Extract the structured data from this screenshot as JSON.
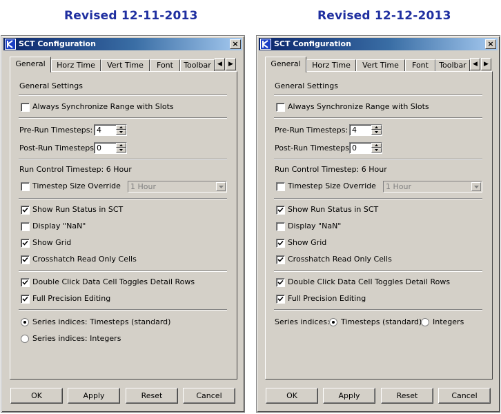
{
  "captions": {
    "left": "Revised 12-11-2013",
    "right": "Revised 12-12-2013"
  },
  "dialog": {
    "title": "SCT Configuration",
    "close_glyph": "×",
    "tabs": [
      "General",
      "Horz Time",
      "Vert Time",
      "Font",
      "Toolbar"
    ],
    "active_tab": "General",
    "section_title": "General Settings",
    "sync_range": {
      "label": "Always Synchronize Range with Slots",
      "checked": false
    },
    "pre_run": {
      "label": "Pre-Run Timesteps:",
      "value": "4"
    },
    "post_run": {
      "label": "Post-Run Timesteps:",
      "value": "0"
    },
    "run_control": "Run Control Timestep:  6 Hour",
    "timestep_override": {
      "label": "Timestep Size Override",
      "checked": false,
      "combo_value": "1 Hour"
    },
    "show_run_status": {
      "label": "Show Run Status in SCT",
      "checked": true
    },
    "display_nan": {
      "label": "Display \"NaN\"",
      "checked": false
    },
    "show_grid": {
      "label": "Show Grid",
      "checked": true
    },
    "crosshatch": {
      "label": "Crosshatch Read Only Cells",
      "checked": true
    },
    "double_click": {
      "label": "Double Click Data Cell Toggles Detail Rows",
      "checked": true
    },
    "full_precision": {
      "label": "Full Precision Editing",
      "checked": true
    },
    "buttons": {
      "ok": "OK",
      "apply": "Apply",
      "reset": "Reset",
      "cancel": "Cancel"
    }
  },
  "left_series": {
    "timesteps_label": "Series indices: Timesteps (standard)",
    "integers_label": "Series indices: Integers",
    "selected": "timesteps"
  },
  "right_series": {
    "prefix": "Series indices:",
    "timesteps_label": "Timesteps (standard)",
    "integers_label": "Integers",
    "selected": "timesteps"
  }
}
